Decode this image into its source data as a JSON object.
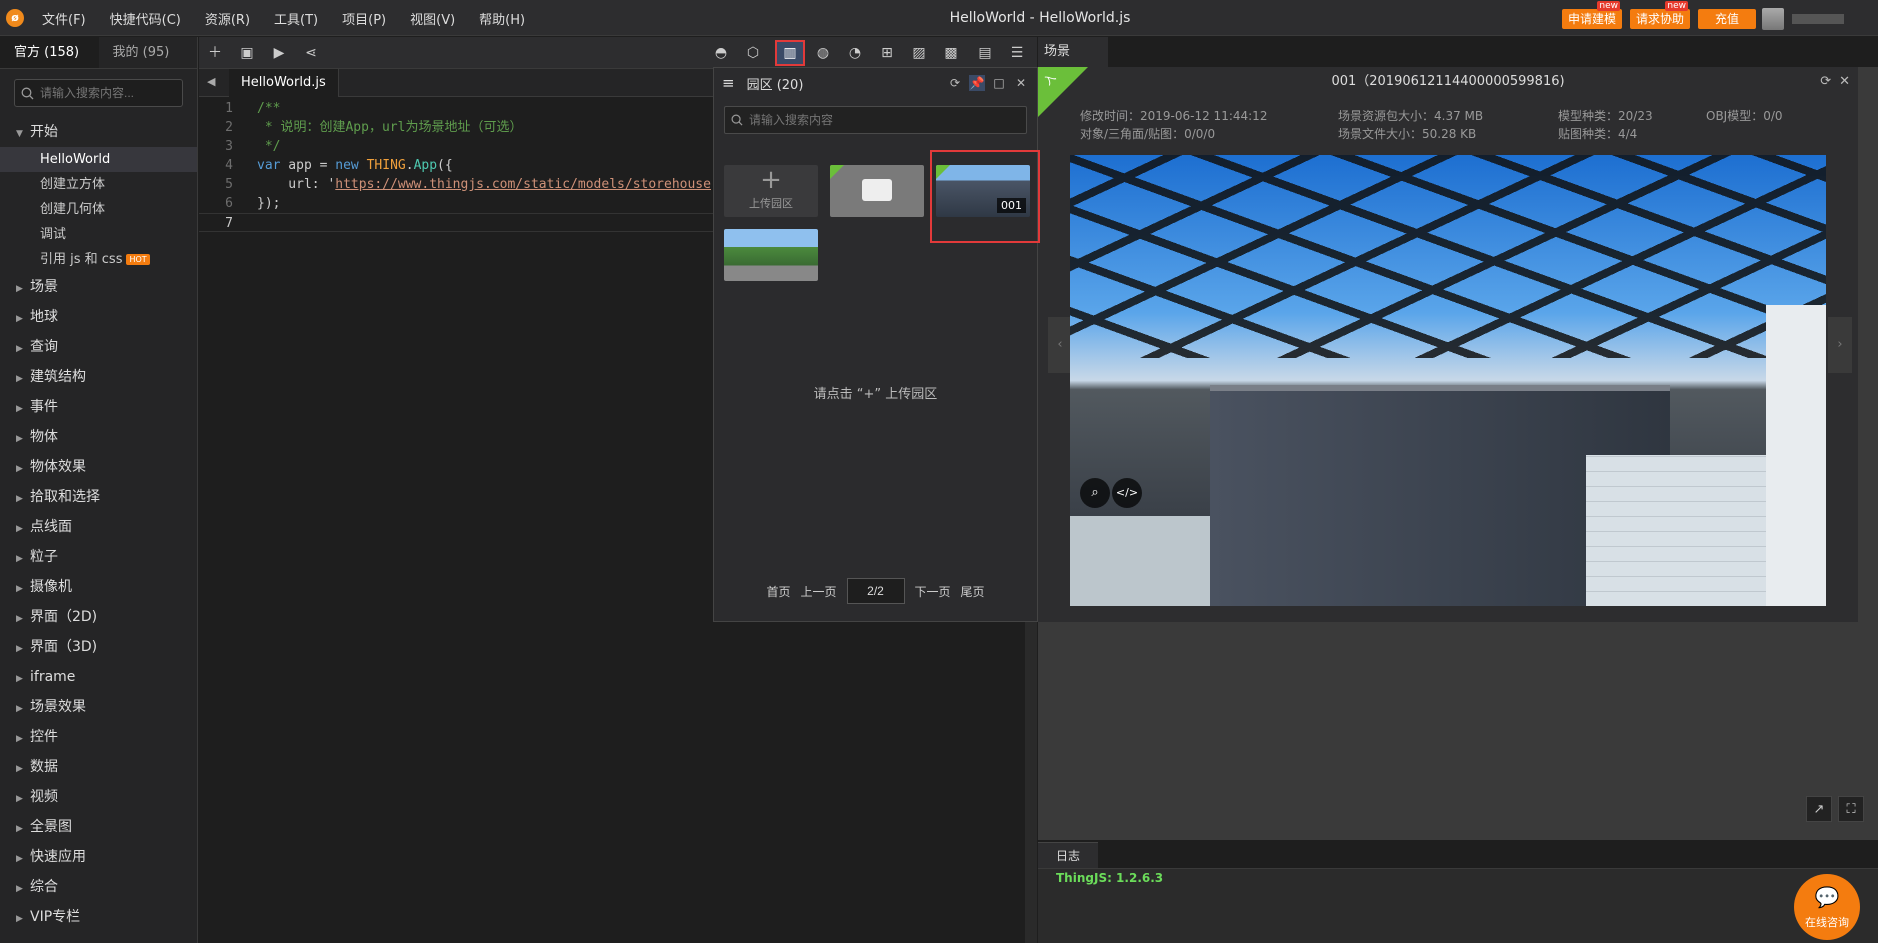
{
  "menubar": {
    "logo": "ø",
    "items": [
      "文件(F)",
      "快捷代码(C)",
      "资源(R)",
      "工具(T)",
      "项目(P)",
      "视图(V)",
      "帮助(H)"
    ],
    "title": "HelloWorld -  HelloWorld.js",
    "buttons": {
      "modeling": "申请建模",
      "assist": "请求协助",
      "recharge": "充值"
    },
    "new_tag": "new"
  },
  "left": {
    "tabs": [
      "官方 (158)",
      "我的 (95)"
    ],
    "search_placeholder": "请输入搜索内容...",
    "open_group": "开始",
    "items": [
      "HelloWorld",
      "创建立方体",
      "创建几何体",
      "调试",
      "引用 js 和 css"
    ],
    "hot": "HOT",
    "groups": [
      "场景",
      "地球",
      "查询",
      "建筑结构",
      "事件",
      "物体",
      "物体效果",
      "拾取和选择",
      "点线面",
      "粒子",
      "摄像机",
      "界面（2D)",
      "界面（3D)",
      "iframe",
      "场景效果",
      "控件",
      "数据",
      "视频",
      "全景图",
      "快速应用",
      "综合",
      "VIP专栏"
    ]
  },
  "editor": {
    "file_tab": "HelloWorld.js",
    "line_numbers": [
      "1",
      "2",
      "3",
      "4",
      "5",
      "6",
      "7"
    ],
    "code": {
      "l1": "/**",
      "l2": " * 说明：创建App，url为场景地址（可选）",
      "l3": " */",
      "l4_kw": "var",
      "l4_a": " app = ",
      "l4_new": "new",
      "l4_cls": " THING",
      "l4_dot": ".",
      "l4_fn": "App",
      "l4_end": "({",
      "l5_key": "    url: '",
      "l5_str": "https://www.thingjs.com/static/models/storehouse",
      "l6": "});"
    }
  },
  "park": {
    "title": "园区 (20)",
    "search_placeholder": "请输入搜索内容",
    "upload": "上传园区",
    "selected_label": "001",
    "hint": "请点击 “+” 上传园区",
    "pager": {
      "first": "首页",
      "prev": "上一页",
      "page": "2/2",
      "next": "下一页",
      "last": "尾页"
    }
  },
  "scene": {
    "tab": "场景",
    "corner_tag": "入",
    "title": "001（20190612114400000599816)",
    "meta": {
      "modified": "修改时间：2019-06-12 11:44:12",
      "objects": "对象/三角面/贴图：0/0/0",
      "pkg_size": "场景资源包大小：4.37 MB",
      "file_size": "场景文件大小：50.28 KB",
      "model_types": "模型种类：20/23",
      "texture_types": "贴图种类：4/4",
      "obj_models": "OBJ模型：0/0"
    }
  },
  "log": {
    "tab": "日志",
    "line": "ThingJS: 1.2.6.3"
  },
  "chat": {
    "label": "在线咨询"
  }
}
